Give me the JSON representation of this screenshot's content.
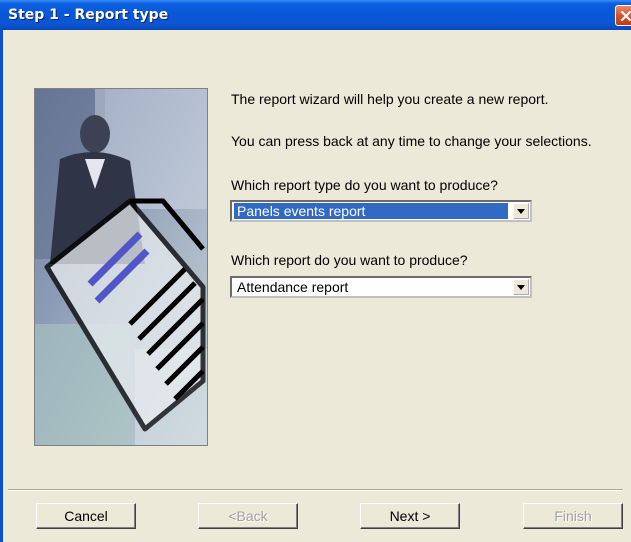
{
  "window": {
    "title": "Step 1 - Report type"
  },
  "intro": {
    "line1": "The report wizard will help you create a new report.",
    "line2": "You can press back at any time to change your selections."
  },
  "report_type": {
    "label": "Which report type do you want to produce?",
    "selected": "Panels events report"
  },
  "report": {
    "label": "Which report do you want to produce?",
    "selected": "Attendance report"
  },
  "buttons": {
    "cancel": "Cancel",
    "back": "<Back",
    "next": "Next >",
    "finish": "Finish"
  },
  "icons": {
    "close": "close-icon",
    "dropdown": "chevron-down-icon"
  },
  "colors": {
    "titlebar": "#0a58d8",
    "selection": "#316ac5",
    "dialog_bg": "#ece9d8"
  }
}
